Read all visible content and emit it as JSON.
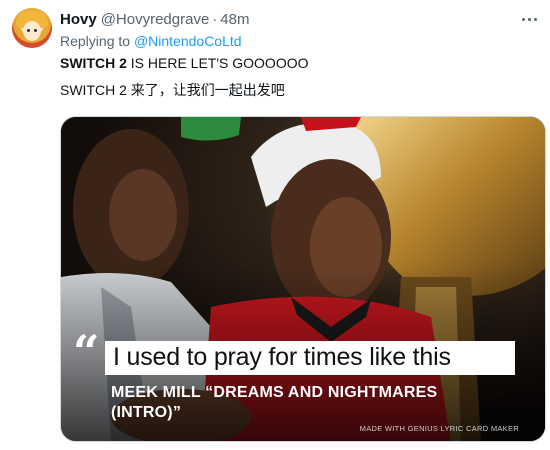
{
  "author": {
    "name": "Hovy",
    "handle": "@Hovyredgrave",
    "separator": "·",
    "time": "48m"
  },
  "reply": {
    "prefix": "Replying to",
    "target": "@NintendoCoLtd"
  },
  "tweet": {
    "line1_bold": "SWITCH 2",
    "line1_rest": " IS HERE LET'S GOOOOOO",
    "line2": "SWITCH 2 来了，让我们一起出发吧"
  },
  "media": {
    "quote_glyph": "“",
    "lyric": "I used to pray for times like this",
    "artist": "MEEK MILL “DREAMS AND NIGHTMARES (INTRO)”",
    "watermark": "MADE WITH GENIUS LYRIC CARD MAKER"
  },
  "icons": {
    "more": "more-horizontal-icon"
  }
}
